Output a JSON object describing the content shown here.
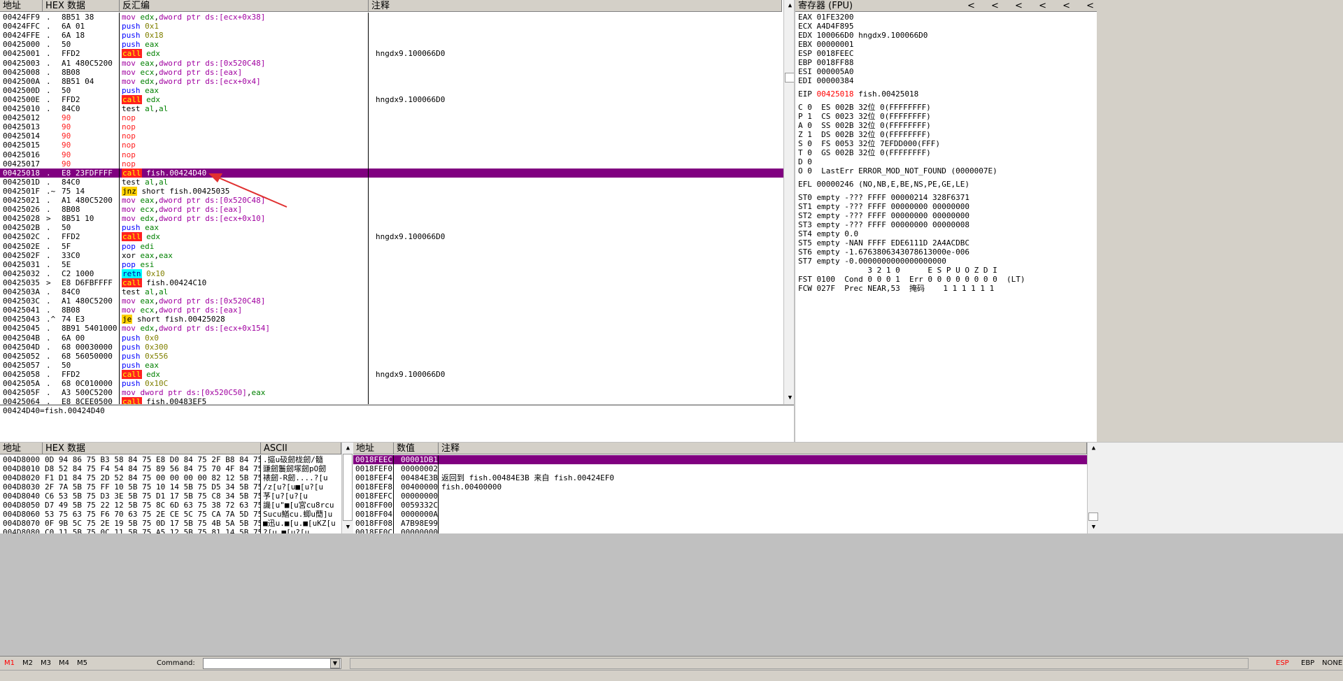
{
  "disasm": {
    "headers": {
      "addr": "地址",
      "hex": "HEX 数据",
      "dis": "反汇编",
      "comment": "注释"
    },
    "rows": [
      {
        "addr": "00424FF9",
        "mk": ".",
        "hex": "8B51 38",
        "mn": "mov",
        "mc": "mov",
        "ops": [
          [
            "edx",
            "reg"
          ],
          [
            ",",
            ""
          ],
          [
            "dword ptr ds:[ecx+0x38]",
            "mem"
          ]
        ],
        "comment": ""
      },
      {
        "addr": "00424FFC",
        "mk": ".",
        "hex": "6A 01",
        "mn": "push",
        "mc": "push",
        "ops": [
          [
            "0x1",
            "imm"
          ]
        ],
        "comment": ""
      },
      {
        "addr": "00424FFE",
        "mk": ".",
        "hex": "6A 18",
        "mn": "push",
        "mc": "push",
        "ops": [
          [
            "0x18",
            "imm"
          ]
        ],
        "comment": ""
      },
      {
        "addr": "00425000",
        "mk": ".",
        "hex": "50",
        "mn": "push",
        "mc": "push",
        "ops": [
          [
            "eax",
            "reg"
          ]
        ],
        "comment": ""
      },
      {
        "addr": "00425001",
        "mk": ".",
        "hex": "FFD2",
        "mn": "call",
        "mc": "call",
        "ops": [
          [
            "edx",
            "reg"
          ]
        ],
        "comment": "hngdx9.100066D0"
      },
      {
        "addr": "00425003",
        "mk": ".",
        "hex": "A1 480C5200",
        "mn": "mov",
        "mc": "mov",
        "ops": [
          [
            "eax",
            "reg"
          ],
          [
            ",",
            ""
          ],
          [
            "dword ptr ds:[0x520C48]",
            "mem"
          ]
        ],
        "comment": ""
      },
      {
        "addr": "00425008",
        "mk": ".",
        "hex": "8B08",
        "mn": "mov",
        "mc": "mov",
        "ops": [
          [
            "ecx",
            "reg"
          ],
          [
            ",",
            ""
          ],
          [
            "dword ptr ds:[eax]",
            "mem"
          ]
        ],
        "comment": ""
      },
      {
        "addr": "0042500A",
        "mk": ".",
        "hex": "8B51 04",
        "mn": "mov",
        "mc": "mov",
        "ops": [
          [
            "edx",
            "reg"
          ],
          [
            ",",
            ""
          ],
          [
            "dword ptr ds:[ecx+0x4]",
            "mem"
          ]
        ],
        "comment": ""
      },
      {
        "addr": "0042500D",
        "mk": ".",
        "hex": "50",
        "mn": "push",
        "mc": "push",
        "ops": [
          [
            "eax",
            "reg"
          ]
        ],
        "comment": ""
      },
      {
        "addr": "0042500E",
        "mk": ".",
        "hex": "FFD2",
        "mn": "call",
        "mc": "call",
        "ops": [
          [
            "edx",
            "reg"
          ]
        ],
        "comment": "hngdx9.100066D0"
      },
      {
        "addr": "00425010",
        "mk": ".",
        "hex": "84C0",
        "mn": "test",
        "mc": "test",
        "ops": [
          [
            "al",
            "reg"
          ],
          [
            ",",
            ""
          ],
          [
            "al",
            "reg"
          ]
        ],
        "comment": ""
      },
      {
        "addr": "00425012",
        "mk": "",
        "hex": "90",
        "hexred": true,
        "mn": "nop",
        "mc": "nop",
        "ops": [],
        "comment": ""
      },
      {
        "addr": "00425013",
        "mk": "",
        "hex": "90",
        "hexred": true,
        "mn": "nop",
        "mc": "nop",
        "ops": [],
        "comment": ""
      },
      {
        "addr": "00425014",
        "mk": "",
        "hex": "90",
        "hexred": true,
        "mn": "nop",
        "mc": "nop",
        "ops": [],
        "comment": ""
      },
      {
        "addr": "00425015",
        "mk": "",
        "hex": "90",
        "hexred": true,
        "mn": "nop",
        "mc": "nop",
        "ops": [],
        "comment": ""
      },
      {
        "addr": "00425016",
        "mk": "",
        "hex": "90",
        "hexred": true,
        "mn": "nop",
        "mc": "nop",
        "ops": [],
        "comment": ""
      },
      {
        "addr": "00425017",
        "mk": "",
        "hex": "90",
        "hexred": true,
        "mn": "nop",
        "mc": "nop",
        "ops": [],
        "comment": ""
      },
      {
        "addr": "00425018",
        "mk": ".",
        "hex": "E8 23FDFFFF",
        "mn": "call",
        "mc": "call",
        "ops": [
          [
            "fish.00424D40",
            "lbl"
          ]
        ],
        "comment": "",
        "selected": true
      },
      {
        "addr": "0042501D",
        "mk": ".",
        "hex": "84C0",
        "mn": "test",
        "mc": "test",
        "ops": [
          [
            "al",
            "reg"
          ],
          [
            ",",
            ""
          ],
          [
            "al",
            "reg"
          ]
        ],
        "comment": ""
      },
      {
        "addr": "0042501F",
        "mk": ".~",
        "hex": "75 14",
        "mn": "jnz",
        "mc": "jcc",
        "ops": [
          [
            "short fish.00425035",
            "lbl"
          ]
        ],
        "comment": ""
      },
      {
        "addr": "00425021",
        "mk": ".",
        "hex": "A1 480C5200",
        "mn": "mov",
        "mc": "mov",
        "ops": [
          [
            "eax",
            "reg"
          ],
          [
            ",",
            ""
          ],
          [
            "dword ptr ds:[0x520C48]",
            "mem"
          ]
        ],
        "comment": ""
      },
      {
        "addr": "00425026",
        "mk": ".",
        "hex": "8B08",
        "mn": "mov",
        "mc": "mov",
        "ops": [
          [
            "ecx",
            "reg"
          ],
          [
            ",",
            ""
          ],
          [
            "dword ptr ds:[eax]",
            "mem"
          ]
        ],
        "comment": ""
      },
      {
        "addr": "00425028",
        "mk": ">",
        "hex": "8B51 10",
        "mn": "mov",
        "mc": "mov",
        "ops": [
          [
            "edx",
            "reg"
          ],
          [
            ",",
            ""
          ],
          [
            "dword ptr ds:[ecx+0x10]",
            "mem"
          ]
        ],
        "comment": ""
      },
      {
        "addr": "0042502B",
        "mk": ".",
        "hex": "50",
        "mn": "push",
        "mc": "push",
        "ops": [
          [
            "eax",
            "reg"
          ]
        ],
        "comment": ""
      },
      {
        "addr": "0042502C",
        "mk": ".",
        "hex": "FFD2",
        "mn": "call",
        "mc": "call",
        "ops": [
          [
            "edx",
            "reg"
          ]
        ],
        "comment": "hngdx9.100066D0"
      },
      {
        "addr": "0042502E",
        "mk": ".",
        "hex": "5F",
        "mn": "pop",
        "mc": "pop",
        "ops": [
          [
            "edi",
            "reg"
          ]
        ],
        "comment": ""
      },
      {
        "addr": "0042502F",
        "mk": ".",
        "hex": "33C0",
        "mn": "xor",
        "mc": "xor",
        "ops": [
          [
            "eax",
            "reg"
          ],
          [
            ",",
            ""
          ],
          [
            "eax",
            "reg"
          ]
        ],
        "comment": ""
      },
      {
        "addr": "00425031",
        "mk": ".",
        "hex": "5E",
        "mn": "pop",
        "mc": "pop",
        "ops": [
          [
            "esi",
            "reg"
          ]
        ],
        "comment": ""
      },
      {
        "addr": "00425032",
        "mk": ".",
        "hex": "C2 1000",
        "mn": "retn",
        "mc": "retn",
        "ops": [
          [
            "0x10",
            "imm"
          ]
        ],
        "comment": ""
      },
      {
        "addr": "00425035",
        "mk": ">",
        "hex": "E8 D6FBFFFF",
        "mn": "call",
        "mc": "call",
        "ops": [
          [
            "fish.00424C10",
            "lbl"
          ]
        ],
        "comment": ""
      },
      {
        "addr": "0042503A",
        "mk": ".",
        "hex": "84C0",
        "mn": "test",
        "mc": "test",
        "ops": [
          [
            "al",
            "reg"
          ],
          [
            ",",
            ""
          ],
          [
            "al",
            "reg"
          ]
        ],
        "comment": ""
      },
      {
        "addr": "0042503C",
        "mk": ".",
        "hex": "A1 480C5200",
        "mn": "mov",
        "mc": "mov",
        "ops": [
          [
            "eax",
            "reg"
          ],
          [
            ",",
            ""
          ],
          [
            "dword ptr ds:[0x520C48]",
            "mem"
          ]
        ],
        "comment": ""
      },
      {
        "addr": "00425041",
        "mk": ".",
        "hex": "8B08",
        "mn": "mov",
        "mc": "mov",
        "ops": [
          [
            "ecx",
            "reg"
          ],
          [
            ",",
            ""
          ],
          [
            "dword ptr ds:[eax]",
            "mem"
          ]
        ],
        "comment": ""
      },
      {
        "addr": "00425043",
        "mk": ".^",
        "hex": "74 E3",
        "mn": "je",
        "mc": "jcc",
        "ops": [
          [
            "short fish.00425028",
            "lbl"
          ]
        ],
        "comment": ""
      },
      {
        "addr": "00425045",
        "mk": ".",
        "hex": "8B91 5401000",
        "mn": "mov",
        "mc": "mov",
        "ops": [
          [
            "edx",
            "reg"
          ],
          [
            ",",
            ""
          ],
          [
            "dword ptr ds:[ecx+0x154]",
            "mem"
          ]
        ],
        "comment": ""
      },
      {
        "addr": "0042504B",
        "mk": ".",
        "hex": "6A 00",
        "mn": "push",
        "mc": "push",
        "ops": [
          [
            "0x0",
            "imm"
          ]
        ],
        "comment": ""
      },
      {
        "addr": "0042504D",
        "mk": ".",
        "hex": "68 00030000",
        "mn": "push",
        "mc": "push",
        "ops": [
          [
            "0x300",
            "imm"
          ]
        ],
        "comment": ""
      },
      {
        "addr": "00425052",
        "mk": ".",
        "hex": "68 56050000",
        "mn": "push",
        "mc": "push",
        "ops": [
          [
            "0x556",
            "imm"
          ]
        ],
        "comment": ""
      },
      {
        "addr": "00425057",
        "mk": ".",
        "hex": "50",
        "mn": "push",
        "mc": "push",
        "ops": [
          [
            "eax",
            "reg"
          ]
        ],
        "comment": ""
      },
      {
        "addr": "00425058",
        "mk": ".",
        "hex": "FFD2",
        "mn": "call",
        "mc": "call",
        "ops": [
          [
            "edx",
            "reg"
          ]
        ],
        "comment": "hngdx9.100066D0"
      },
      {
        "addr": "0042505A",
        "mk": ".",
        "hex": "68 0C010000",
        "mn": "push",
        "mc": "push",
        "ops": [
          [
            "0x10C",
            "imm"
          ]
        ],
        "comment": ""
      },
      {
        "addr": "0042505F",
        "mk": ".",
        "hex": "A3 500C5200",
        "mn": "mov",
        "mc": "mov",
        "ops": [
          [
            "dword ptr ds:[0x520C50]",
            "mem"
          ],
          [
            ",",
            ""
          ],
          [
            "eax",
            "reg"
          ]
        ],
        "comment": ""
      },
      {
        "addr": "00425064",
        "mk": ".",
        "hex": "E8 8CEE0500",
        "mn": "call",
        "mc": "call",
        "ops": [
          [
            "fish.00483EF5",
            "lbl"
          ]
        ],
        "comment": ""
      }
    ],
    "info_line": "00424D40=fish.00424D40"
  },
  "registers": {
    "title": "寄存器 (FPU)",
    "nav": "< < < < < <",
    "lines": [
      {
        "t": "EAX 01FE3200"
      },
      {
        "t": "ECX A4D4F895"
      },
      {
        "t": "EDX 100066D0 hngdx9.100066D0"
      },
      {
        "t": "EBX 00000001"
      },
      {
        "t": "ESP 0018FEEC"
      },
      {
        "t": "EBP 0018FF88"
      },
      {
        "t": "ESI 000005A0"
      },
      {
        "t": "EDI 00000384"
      },
      {
        "t": ""
      },
      {
        "t": "EIP ",
        "red": "00425018",
        "t2": " fish.00425018"
      },
      {
        "t": ""
      },
      {
        "t": "C 0  ES 002B 32位 0(FFFFFFFF)"
      },
      {
        "t": "P 1  CS 0023 32位 0(FFFFFFFF)"
      },
      {
        "t": "A 0  SS 002B 32位 0(FFFFFFFF)"
      },
      {
        "t": "Z 1  DS 002B 32位 0(FFFFFFFF)"
      },
      {
        "t": "S 0  FS 0053 32位 7EFDD000(FFF)"
      },
      {
        "t": "T 0  GS 002B 32位 0(FFFFFFFF)"
      },
      {
        "t": "D 0"
      },
      {
        "t": "O 0  LastErr ERROR_MOD_NOT_FOUND (0000007E)"
      },
      {
        "t": ""
      },
      {
        "t": "EFL 00000246 (NO,NB,E,BE,NS,PE,GE,LE)"
      },
      {
        "t": ""
      },
      {
        "t": "ST0 empty -??? FFFF 00000214 328F6371"
      },
      {
        "t": "ST1 empty -??? FFFF 00000000 00000000"
      },
      {
        "t": "ST2 empty -??? FFFF 00000000 00000000"
      },
      {
        "t": "ST3 empty -??? FFFF 00000000 00000008"
      },
      {
        "t": "ST4 empty 0.0"
      },
      {
        "t": "ST5 empty -NAN FFFF EDE6111D 2A4ACDBC"
      },
      {
        "t": "ST6 empty -1.6763806343078613000e-006"
      },
      {
        "t": "ST7 empty -0.0000000000000000000"
      },
      {
        "t": "               3 2 1 0      E S P U O Z D I"
      },
      {
        "t": "FST 0100  Cond 0 0 0 1  Err 0 0 0 0 0 0 0 0  (LT)"
      },
      {
        "t": "FCW 027F  Prec NEAR,53  掩码    1 1 1 1 1 1"
      }
    ]
  },
  "dump": {
    "headers": {
      "addr": "地址",
      "hex": "HEX 数据",
      "ascii": "ASCII"
    },
    "rows": [
      {
        "addr": "004D8000",
        "hex": "0D 94 86 75 B3 58 84 75 E8 D0 84 75 2F B8 84 75",
        "ascii": ".攨u砐劒栊劒/髓"
      },
      {
        "addr": "004D8010",
        "hex": "D8 52 84 75 F4 54 84 75 89 56 84 75 70 4F 84 75",
        "ascii": "豏劒鬞劒塚劒pO劒"
      },
      {
        "addr": "004D8020",
        "hex": "F1 D1 84 75 2D 52 84 75 00 00 00 00 82 12 5B 75",
        "ascii": "裱劒-R劒....?[u"
      },
      {
        "addr": "004D8030",
        "hex": "2F 7A 5B 75 FF 10 5B 75 10 14 5B 75 D5 34 5B 75",
        "ascii": "/z[u?[u■[u?[u"
      },
      {
        "addr": "004D8040",
        "hex": "C6 53 5B 75 D3 3E 5B 75 D1 17 5B 75 C8 34 5B 75",
        "ascii": "芧[u?[u?[u"
      },
      {
        "addr": "004D8050",
        "hex": "D7 49 5B 75 22 12 5B 75 8C 6D 63 75 38 72 63 75",
        "ascii": "譏[u\"■[u宮cu8rcu"
      },
      {
        "addr": "004D8060",
        "hex": "53 75 63 75 F6 70 63 75 2E CE 5C 75 CA 7A 5D 75",
        "ascii": "Sucu鰌cu.蝍u蕑]u"
      },
      {
        "addr": "004D8070",
        "hex": "0F 9B 5C 75 2E 19 5B 75 0D 17 5B 75 4B 5A 5B 75",
        "ascii": "■迅u.■[u.■[uKZ[u"
      },
      {
        "addr": "004D8080",
        "hex": "C0 11 5B 75 0C 11 5B 75 A5 12 5B 75 81 14 5B 75",
        "ascii": "?[u.■[u?[u"
      }
    ]
  },
  "stack": {
    "headers": {
      "addr": "地址",
      "val": "数值",
      "comment": "注释"
    },
    "rows": [
      {
        "addr": "0018FEEC",
        "val": "00001DB1",
        "comment": "",
        "selected": true
      },
      {
        "addr": "0018FEF0",
        "val": "00000002",
        "comment": ""
      },
      {
        "addr": "0018FEF4",
        "val": "00484E3B",
        "comment": "返回到 fish.00484E3B 来自 fish.00424EF0"
      },
      {
        "addr": "0018FEF8",
        "val": "00400000",
        "comment": "fish.00400000"
      },
      {
        "addr": "0018FEFC",
        "val": "00000000",
        "comment": ""
      },
      {
        "addr": "0018FF00",
        "val": "0059332C",
        "comment": ""
      },
      {
        "addr": "0018FF04",
        "val": "0000000A",
        "comment": ""
      },
      {
        "addr": "0018FF08",
        "val": "A7B98E99",
        "comment": ""
      },
      {
        "addr": "0018FF0C",
        "val": "00000000",
        "comment": ""
      }
    ]
  },
  "status": {
    "m": [
      "M1",
      "M2",
      "M3",
      "M4",
      "M5"
    ],
    "command_label": "Command:",
    "right": [
      "ESP",
      "EBP",
      "NONE"
    ]
  },
  "colors": {
    "selection": "#800080",
    "call_bg": "#ff2020",
    "call_fg": "#ffff00",
    "accent_red": "#ff0000"
  }
}
